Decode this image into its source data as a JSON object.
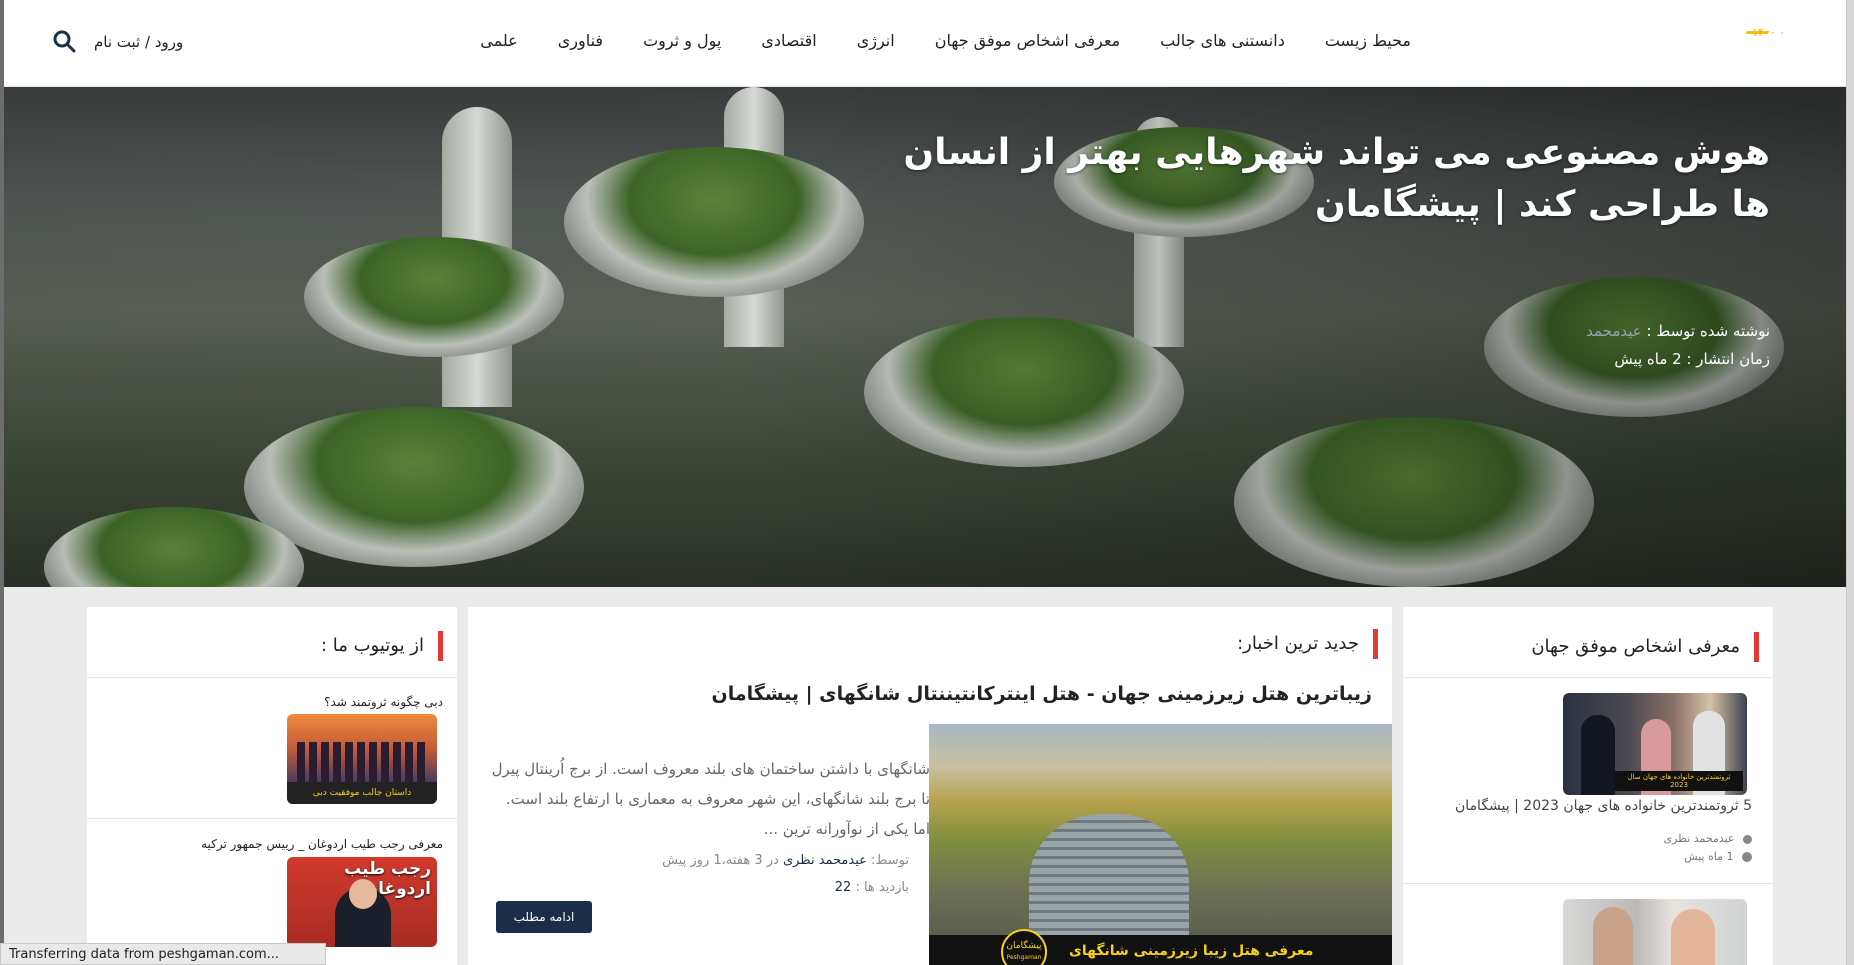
{
  "header": {
    "logo_text": "۱۴۰۰ ۰",
    "nav": [
      "محیط زیست",
      "دانستنی های جالب",
      "معرفی اشخاص موفق جهان",
      "انرژی",
      "اقتصادی",
      "پول و ثروت",
      "فناوری",
      "علمی"
    ],
    "login_label": "ورود / ثبت نام"
  },
  "hero": {
    "title": "هوش مصنوعی می تواند شهرهایی بهتر از انسان ها طراحی کند | پیشگامان",
    "author_label": "نوشته شده توسط :",
    "author": "عیدمحمد",
    "time_label": "زمان انتشار :",
    "time": "2 ماه پیش"
  },
  "youtube": {
    "heading": "از یوتیوب ما :",
    "items": [
      {
        "title": "دبی چگونه ثروتمند شد؟",
        "thumb_caption": "داستان جالب موفقیت دبی"
      },
      {
        "title": "معرفی رجب طیب اردوغان _ رییس جمهور ترکیه",
        "thumb_caption": "رجب طیب اردوغان"
      }
    ]
  },
  "latest": {
    "heading": "جدید ترین اخبار:",
    "title": "زیباترین هتل زیرزمینی جهان - هتل اینترکانتیننتال شانگهای | پیشگامان",
    "excerpt": "شانگهای با داشتن ساختمان های بلند معروف است. از برج اُرینتال پیرل تا برج بلند شانگهای، این شهر معروف به معماری با ارتفاع بلند است. اما یکی از نوآورانه ترین ...",
    "by_label": "توسط:",
    "author": "عیدمحمد نظری",
    "date": "در 3 هفته،1 روز پیش",
    "views_label": "بازدید ها :",
    "views": "22",
    "more_label": "ادامه مطلب",
    "image_caption": "معرفی هتل زیبا زیرزمینی شانگهای",
    "brand": "پیشگامان",
    "brand_en": "Peshgaman"
  },
  "people": {
    "heading": "معرفی اشخاص موفق جهان",
    "item_title": "5 ثروتمندترین خانواده های جهان 2023 | پیشگامان",
    "thumb_caption": "ثروتمندترین خانواده های جهان سال 2023",
    "author": "عیدمحمد نظری",
    "time": "1 ماه پیش"
  },
  "status": {
    "text": "Transferring data from peshgaman.com..."
  },
  "colors": {
    "accent": "#e33b31",
    "button": "#1a2e4a",
    "logo": "#f3c200"
  }
}
